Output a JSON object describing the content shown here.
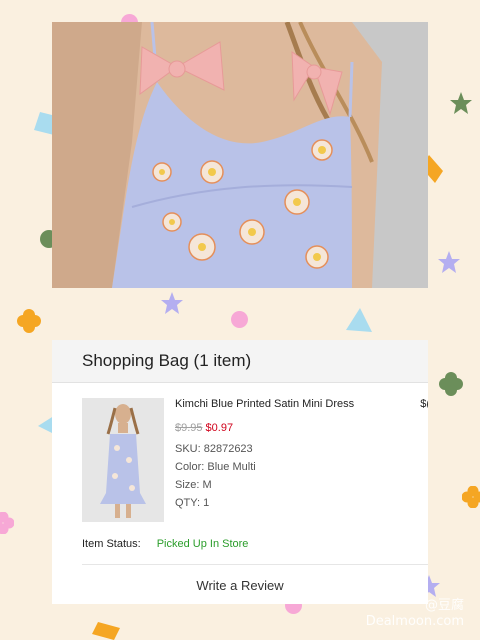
{
  "shopping_bag": {
    "title": "Shopping Bag (1 item)",
    "item": {
      "name": "Kimchi Blue Printed Satin Mini Dress",
      "original_price": "$9.95",
      "sale_price": "$0.97",
      "sku": "SKU: 82872623",
      "color": "Color: Blue Multi",
      "size": "Size: M",
      "qty": "QTY: 1",
      "total_partial": "$("
    },
    "status_label": "Item Status:",
    "status_value": "Picked Up In Store",
    "review_link": "Write a Review"
  },
  "watermark": {
    "line1": "@豆腐",
    "line2": "Dealmoon.com"
  },
  "colors": {
    "background": "#faf0e0",
    "sale_red": "#d0021b",
    "status_green": "#2a9d2a",
    "dress_lavender": "#b9c2e8",
    "bow_pink": "#f1b2b0"
  }
}
